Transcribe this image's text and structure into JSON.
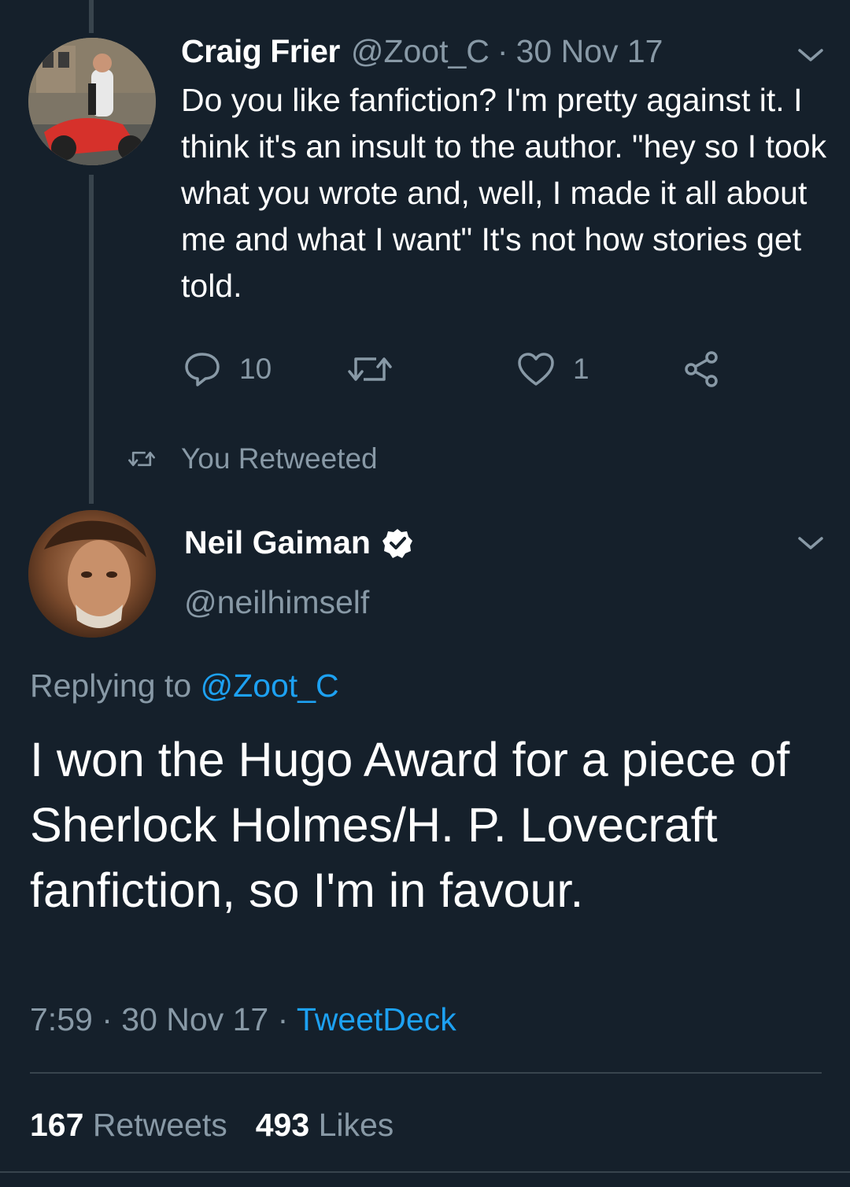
{
  "parent_tweet": {
    "author_name": "Craig Frier",
    "handle": "@Zoot_C",
    "separator": "·",
    "date": "30 Nov 17",
    "text": "Do you like fanfiction? I'm pretty against it. I think it's an insult to the author. \"hey so I took what you wrote and, well, I made it all about me and what I want\" It's not how stories get told.",
    "reply_count": "10",
    "retweet_count": "",
    "like_count": "1"
  },
  "retweet_context": {
    "label": "You Retweeted"
  },
  "main_tweet": {
    "author_name": "Neil Gaiman",
    "handle": "@neilhimself",
    "replying_prefix": "Replying to",
    "replying_to": "@Zoot_C",
    "text": "I won the Hugo Award for a piece of Sherlock Holmes/H. P. Lovecraft fanfiction, so I'm in favour.",
    "time": "7:59",
    "separator": "·",
    "date": "30 Nov 17",
    "source": "TweetDeck",
    "retweets_count": "167",
    "retweets_label": "Retweets",
    "likes_count": "493",
    "likes_label": "Likes"
  },
  "colors": {
    "background": "#15202b",
    "text_primary": "#ffffff",
    "text_secondary": "#8899a6",
    "accent": "#1da1f2",
    "divider": "#38444d"
  },
  "icons": [
    "reply-icon",
    "retweet-icon",
    "like-icon",
    "share-icon",
    "chevron-down-icon",
    "verified-badge-icon"
  ]
}
